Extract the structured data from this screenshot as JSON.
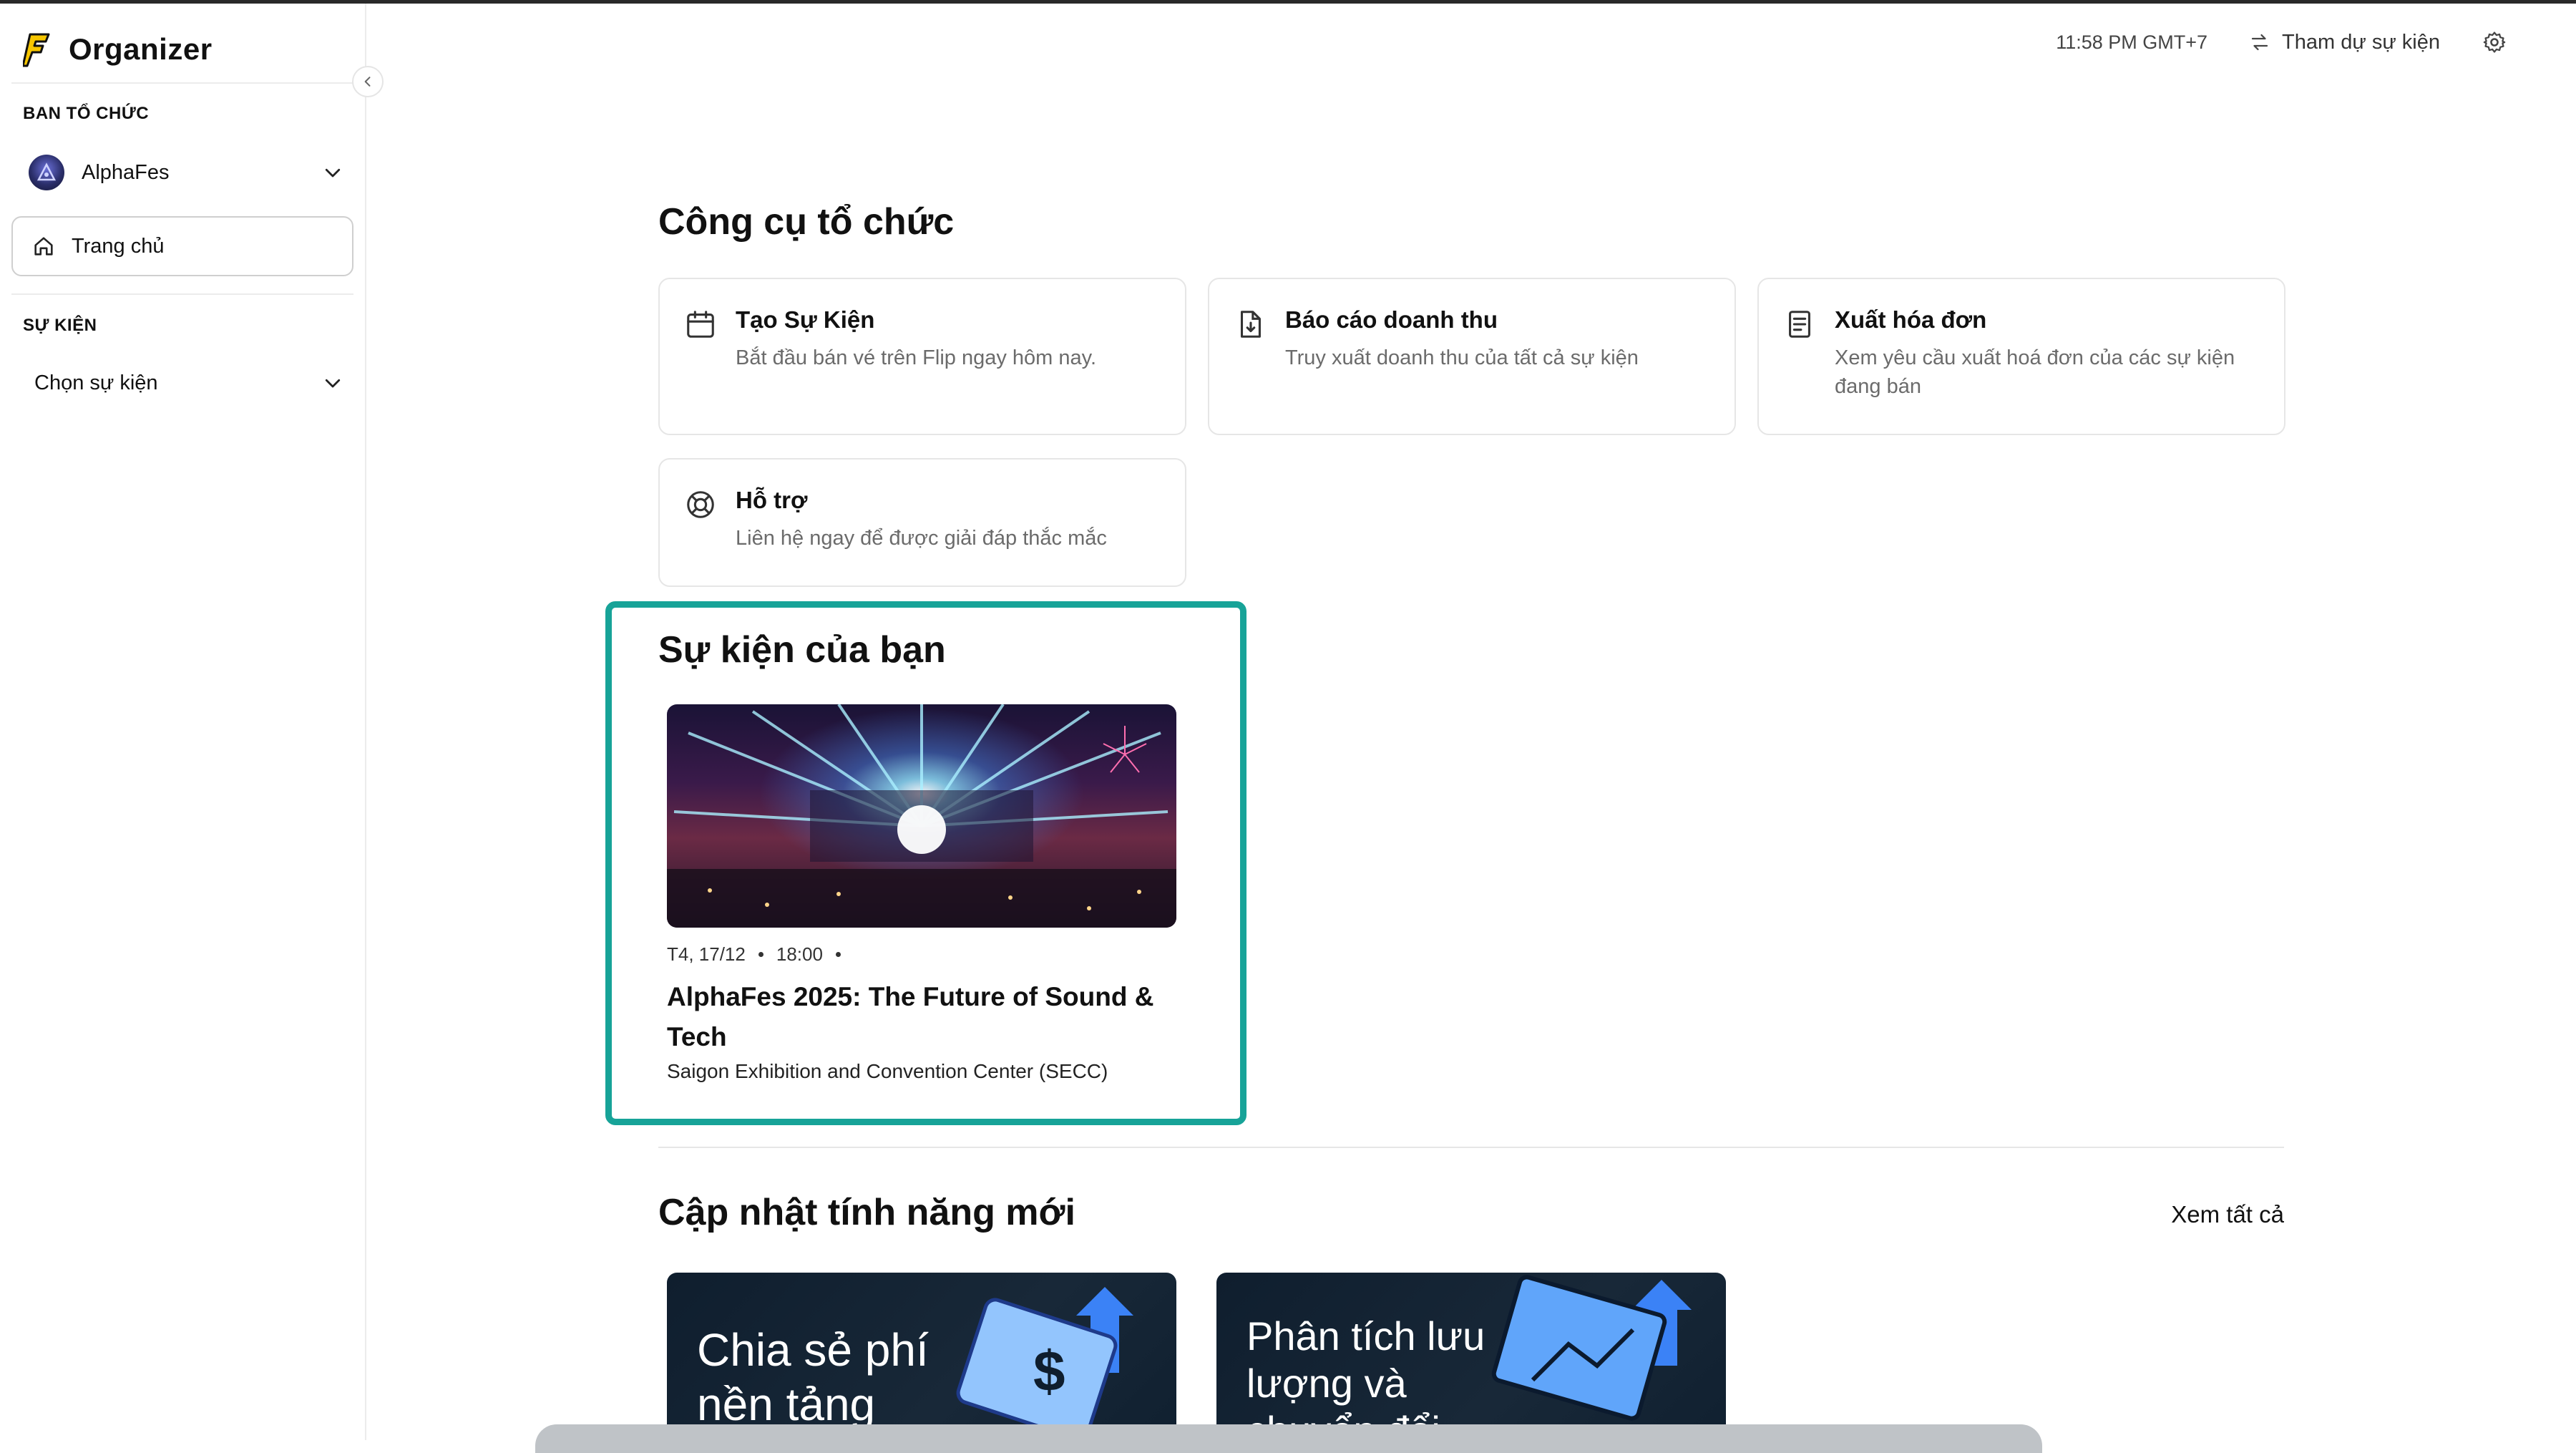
{
  "app": {
    "brand_name": "Organizer",
    "accent_color": "#17a398",
    "brand_color": "#f7c600"
  },
  "sidebar": {
    "organizer_section_label": "BAN TỔ CHỨC",
    "organizer_name": "AlphaFes",
    "home_label": "Trang chủ",
    "events_section_label": "SỰ KIỆN",
    "event_select_label": "Chọn sự kiện"
  },
  "header": {
    "time": "11:58 PM GMT+7",
    "attend_label": "Tham dự sự kiện"
  },
  "tools": {
    "title": "Công cụ tổ chức",
    "cards": [
      {
        "icon": "calendar-icon",
        "title": "Tạo Sự Kiện",
        "desc": "Bắt đầu bán vé trên Flip ngay hôm nay."
      },
      {
        "icon": "report-download-icon",
        "title": "Báo cáo doanh thu",
        "desc": "Truy xuất doanh thu của tất cả sự kiện"
      },
      {
        "icon": "invoice-icon",
        "title": "Xuất hóa đơn",
        "desc": "Xem yêu cầu xuất hoá đơn của các sự kiện đang bán"
      },
      {
        "icon": "lifebuoy-icon",
        "title": "Hỗ trợ",
        "desc": "Liên hệ ngay để được giải đáp thắc mắc"
      }
    ]
  },
  "events": {
    "title": "Sự kiện của bạn",
    "items": [
      {
        "day": "T4, 17/12",
        "time": "18:00",
        "title": "AlphaFes 2025: The Future of Sound & Tech",
        "venue": "Saigon Exhibition and Convention Center (SECC)"
      }
    ]
  },
  "features": {
    "title": "Cập nhật tính năng mới",
    "see_all": "Xem tất cả",
    "cards": [
      {
        "text": "Chia sẻ phí nền tảng"
      },
      {
        "text": "Phân tích lưu lượng và chuyển đổi"
      }
    ]
  }
}
